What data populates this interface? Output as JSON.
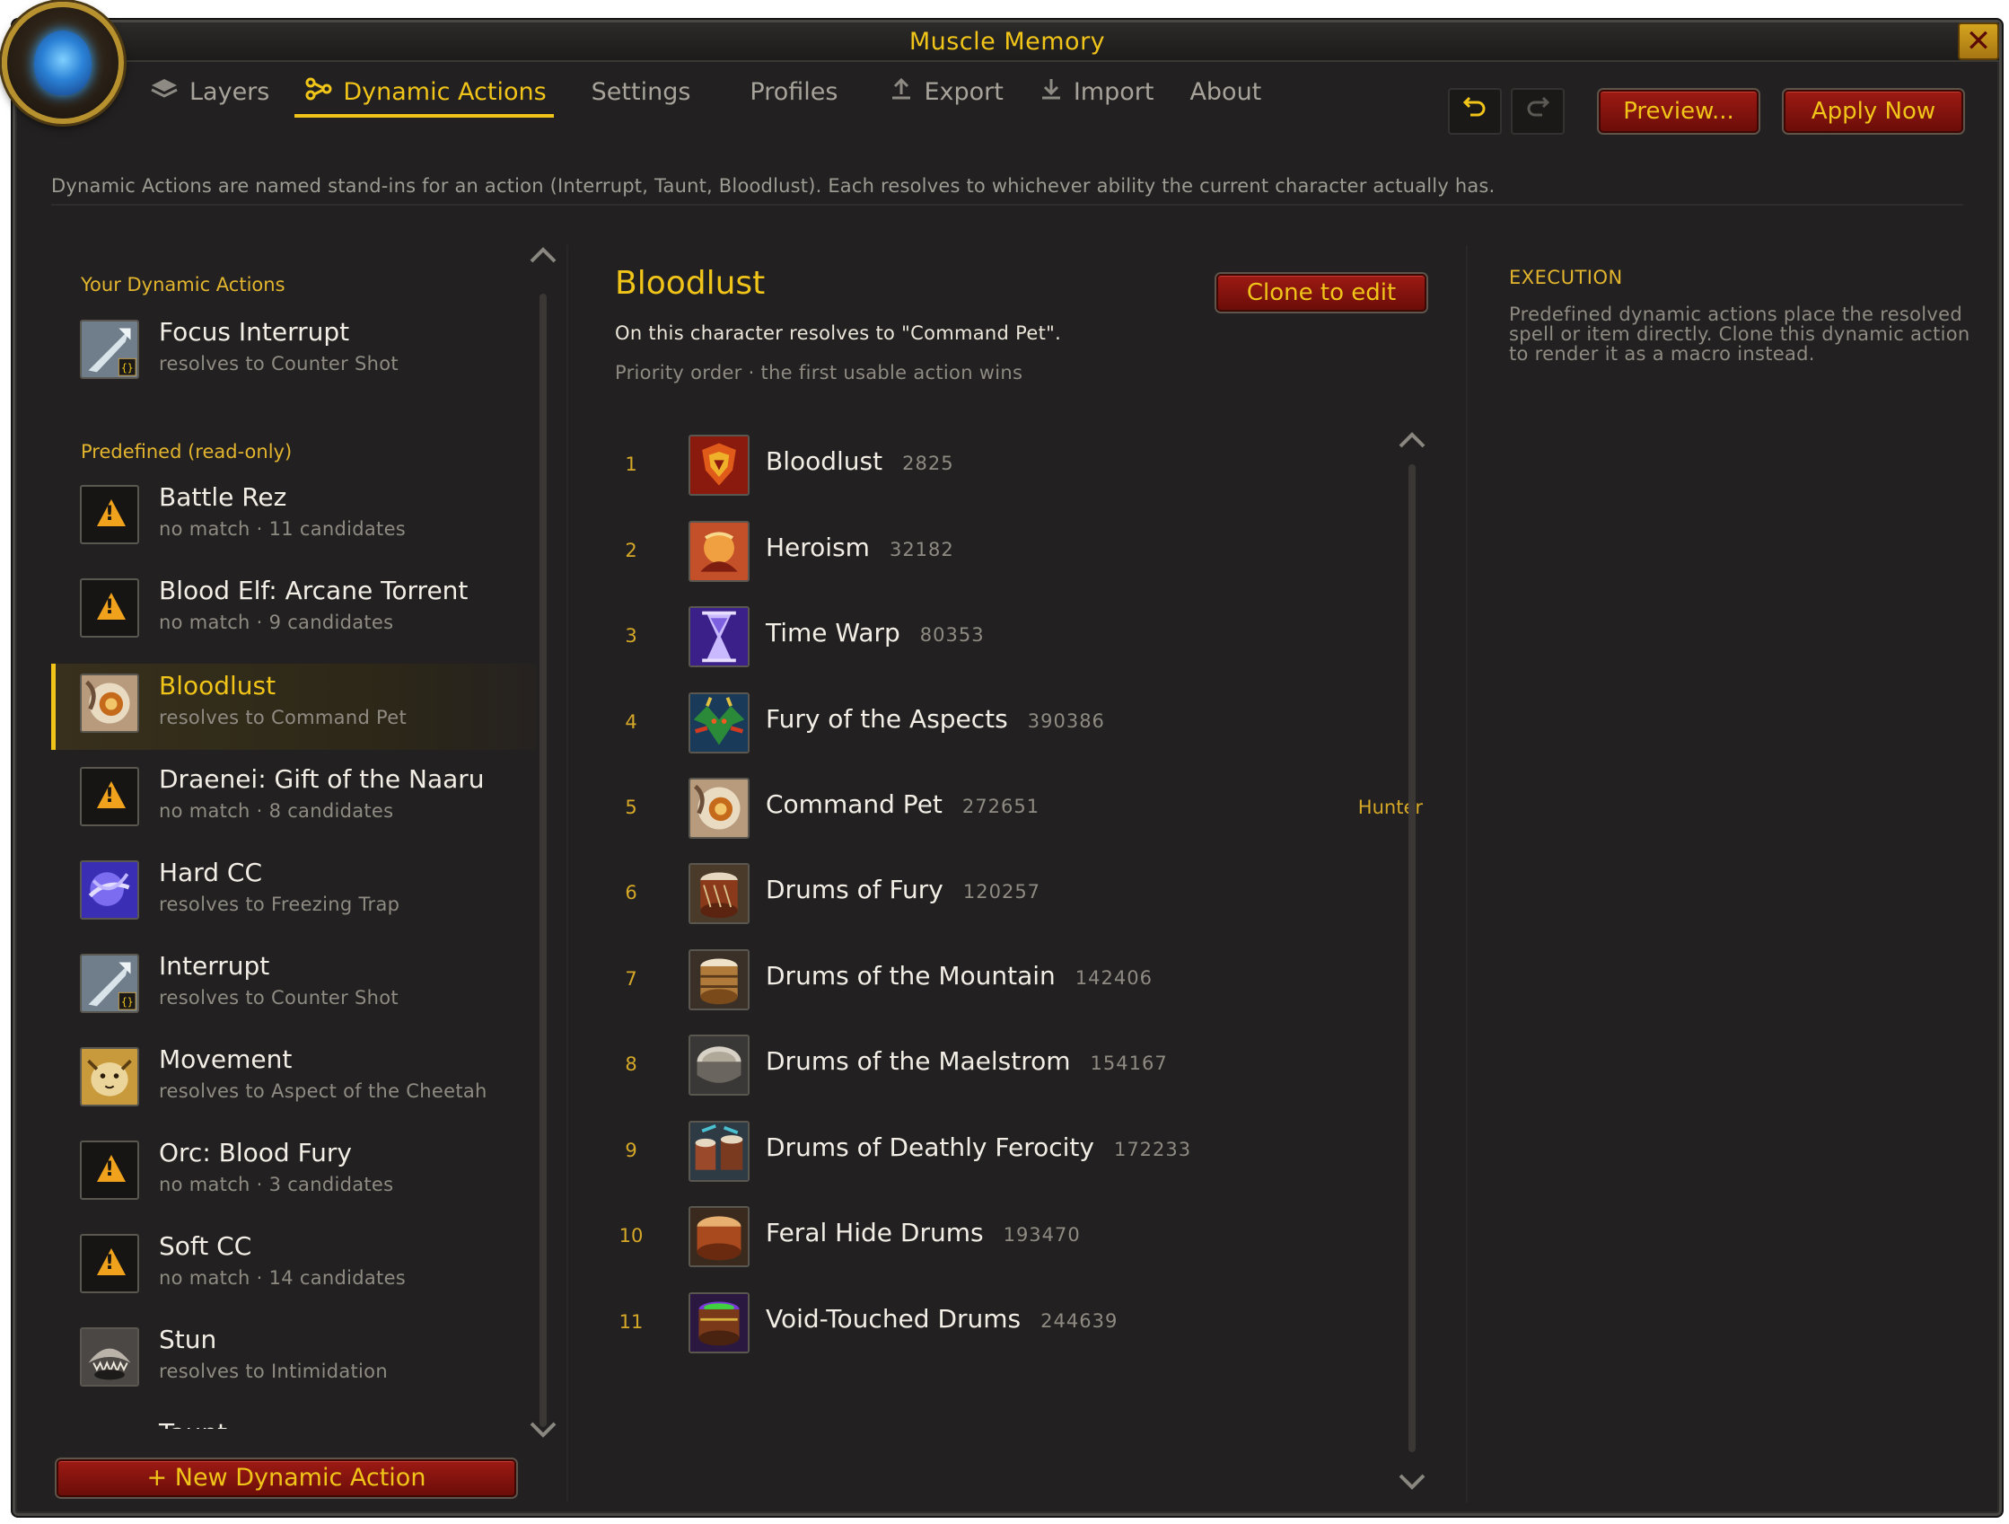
{
  "window": {
    "title": "Muscle Memory"
  },
  "tabs": [
    {
      "label": "Layers",
      "icon": "layers-icon",
      "active": false
    },
    {
      "label": "Dynamic Actions",
      "icon": "nodes-icon",
      "active": true
    },
    {
      "label": "Settings",
      "icon": "",
      "active": false
    },
    {
      "label": "Profiles",
      "icon": "",
      "active": false
    },
    {
      "label": "Export",
      "icon": "upload-icon",
      "active": false
    },
    {
      "label": "Import",
      "icon": "download-icon",
      "active": false
    },
    {
      "label": "About",
      "icon": "",
      "active": false
    }
  ],
  "toolbar": {
    "undo_icon": "undo-icon",
    "redo_icon": "redo-icon",
    "preview_label": "Preview...",
    "apply_label": "Apply Now"
  },
  "info": {
    "text": "Dynamic Actions are named stand-ins for an action (Interrupt, Taunt, Bloodlust). Each resolves to whichever ability the current character actually has."
  },
  "sidebar": {
    "your_title": "Your Dynamic Actions",
    "your_items": [
      {
        "name": "Focus Interrupt",
        "sub": "resolves to Counter Shot",
        "icon": "arrow-macro-icon"
      }
    ],
    "predefined_title": "Predefined (read-only)",
    "predefined_items": [
      {
        "name": "Battle Rez",
        "sub": "no match · 11 candidates",
        "icon": "warning-icon",
        "selected": false
      },
      {
        "name": "Blood Elf: Arcane Torrent",
        "sub": "no match · 9 candidates",
        "icon": "warning-icon",
        "selected": false
      },
      {
        "name": "Bloodlust",
        "sub": "resolves to Command Pet",
        "icon": "command-pet-icon",
        "selected": true
      },
      {
        "name": "Draenei: Gift of the Naaru",
        "sub": "no match · 8 candidates",
        "icon": "warning-icon",
        "selected": false
      },
      {
        "name": "Hard CC",
        "sub": "resolves to Freezing Trap",
        "icon": "freezing-trap-icon",
        "selected": false
      },
      {
        "name": "Interrupt",
        "sub": "resolves to Counter Shot",
        "icon": "arrow-macro-icon",
        "selected": false
      },
      {
        "name": "Movement",
        "sub": "resolves to Aspect of the Cheetah",
        "icon": "cheetah-icon",
        "selected": false
      },
      {
        "name": "Orc: Blood Fury",
        "sub": "no match · 3 candidates",
        "icon": "warning-icon",
        "selected": false
      },
      {
        "name": "Soft CC",
        "sub": "no match · 14 candidates",
        "icon": "warning-icon",
        "selected": false
      },
      {
        "name": "Stun",
        "sub": "resolves to Intimidation",
        "icon": "intimidation-icon",
        "selected": false
      },
      {
        "name": "Taunt",
        "sub": "",
        "icon": "taunt-icon",
        "selected": false
      }
    ],
    "new_button": "+ New Dynamic Action"
  },
  "detail": {
    "title": "Bloodlust",
    "clone_label": "Clone to edit",
    "resolves": "On this character resolves to \"Command Pet\".",
    "priority": "Priority order · the first usable action wins",
    "rows": [
      {
        "num": "1",
        "name": "Bloodlust",
        "id": "2825",
        "class": "",
        "icon": "bloodlust-icon"
      },
      {
        "num": "2",
        "name": "Heroism",
        "id": "32182",
        "class": "",
        "icon": "heroism-icon"
      },
      {
        "num": "3",
        "name": "Time Warp",
        "id": "80353",
        "class": "",
        "icon": "hourglass-icon"
      },
      {
        "num": "4",
        "name": "Fury of the Aspects",
        "id": "390386",
        "class": "",
        "icon": "dragon-icon"
      },
      {
        "num": "5",
        "name": "Command Pet",
        "id": "272651",
        "class": "Hunter",
        "icon": "command-pet-icon"
      },
      {
        "num": "6",
        "name": "Drums of Fury",
        "id": "120257",
        "class": "",
        "icon": "drum-icon"
      },
      {
        "num": "7",
        "name": "Drums of the Mountain",
        "id": "142406",
        "class": "",
        "icon": "drum-icon"
      },
      {
        "num": "8",
        "name": "Drums of the Maelstrom",
        "id": "154167",
        "class": "",
        "icon": "drum-icon"
      },
      {
        "num": "9",
        "name": "Drums of Deathly Ferocity",
        "id": "172233",
        "class": "",
        "icon": "drums-pair-icon"
      },
      {
        "num": "10",
        "name": "Feral Hide Drums",
        "id": "193470",
        "class": "",
        "icon": "drum-icon"
      },
      {
        "num": "11",
        "name": "Void-Touched Drums",
        "id": "244639",
        "class": "",
        "icon": "void-drum-icon"
      }
    ]
  },
  "execution": {
    "title": "EXECUTION",
    "text": "Predefined dynamic actions place the resolved spell or item directly. Clone this dynamic action to render it as a macro instead."
  },
  "colors": {
    "accent": "#f0c419",
    "button_red": "#8c1711",
    "panel": "#222020"
  }
}
